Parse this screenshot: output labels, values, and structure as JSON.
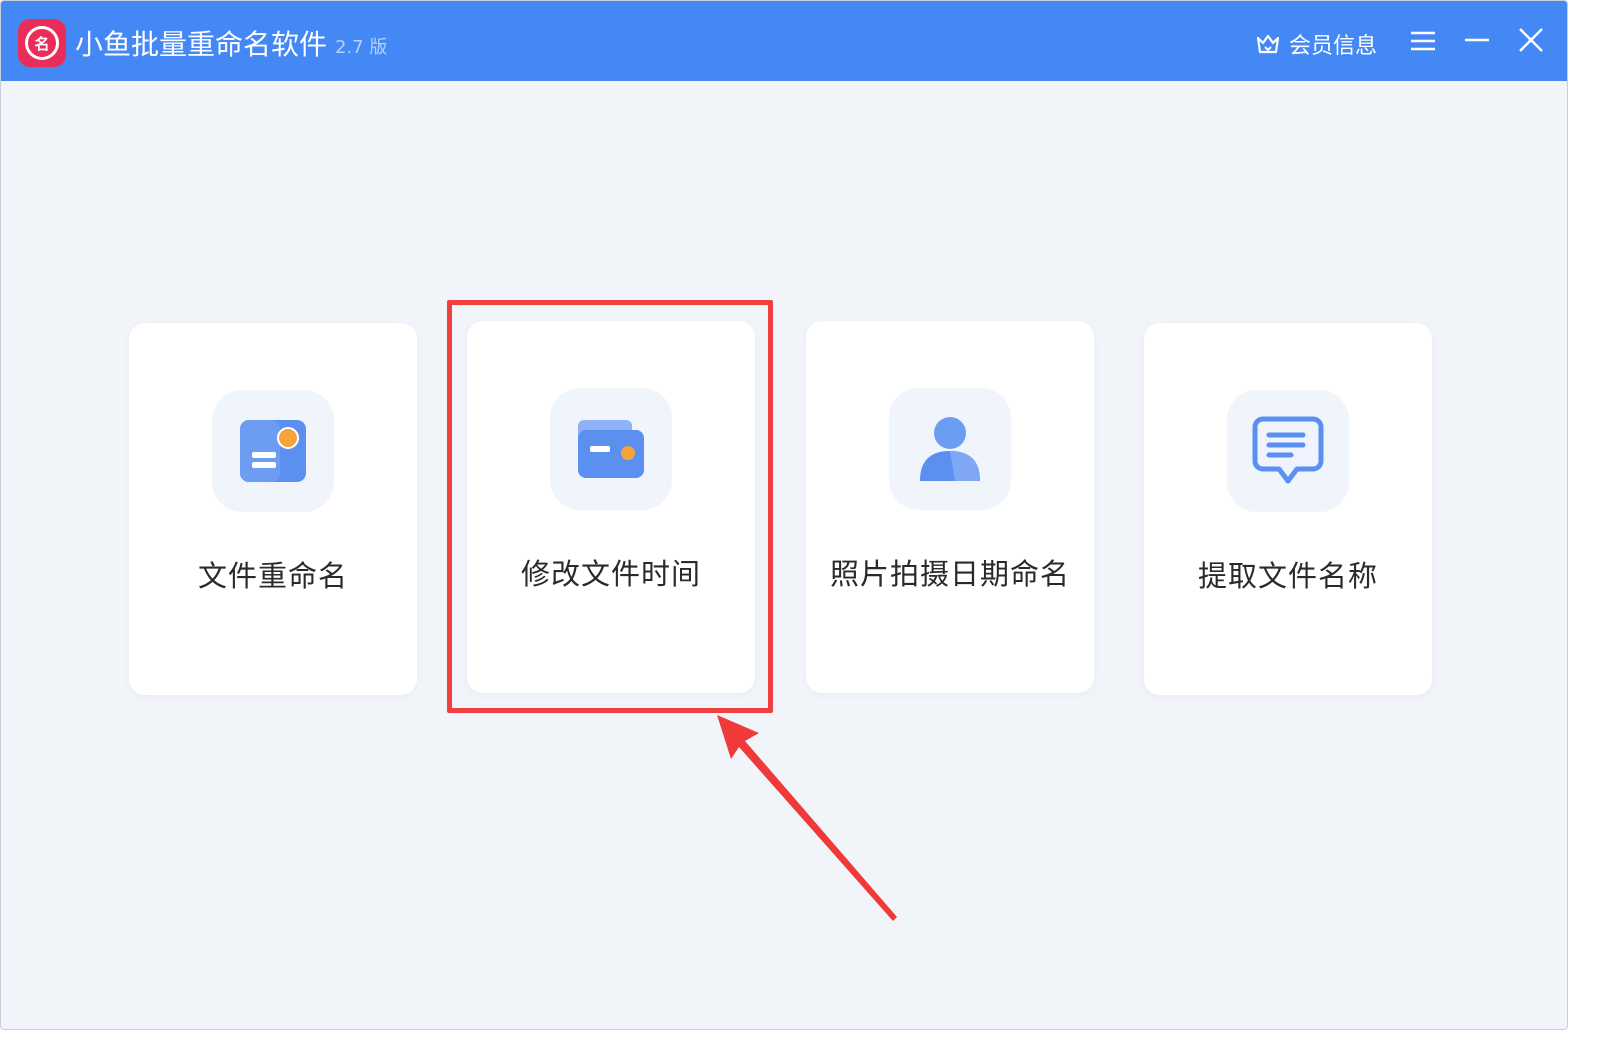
{
  "app": {
    "logo_text": "名",
    "title": "小鱼批量重命名软件",
    "version": "2.7 版"
  },
  "header": {
    "vip_label": "会员信息"
  },
  "cards": [
    {
      "label": "文件重命名",
      "icon": "file-rename-icon"
    },
    {
      "label": "修改文件时间",
      "icon": "file-time-icon"
    },
    {
      "label": "照片拍摄日期命名",
      "icon": "person-icon"
    },
    {
      "label": "提取文件名称",
      "icon": "chat-doc-icon"
    }
  ],
  "colors": {
    "titlebar": "#4488f5",
    "logo": "#ea2c58",
    "background": "#f1f4f9",
    "icon_blue": "#5b8ff0",
    "icon_orange": "#f5a43a",
    "highlight": "#f04040"
  }
}
